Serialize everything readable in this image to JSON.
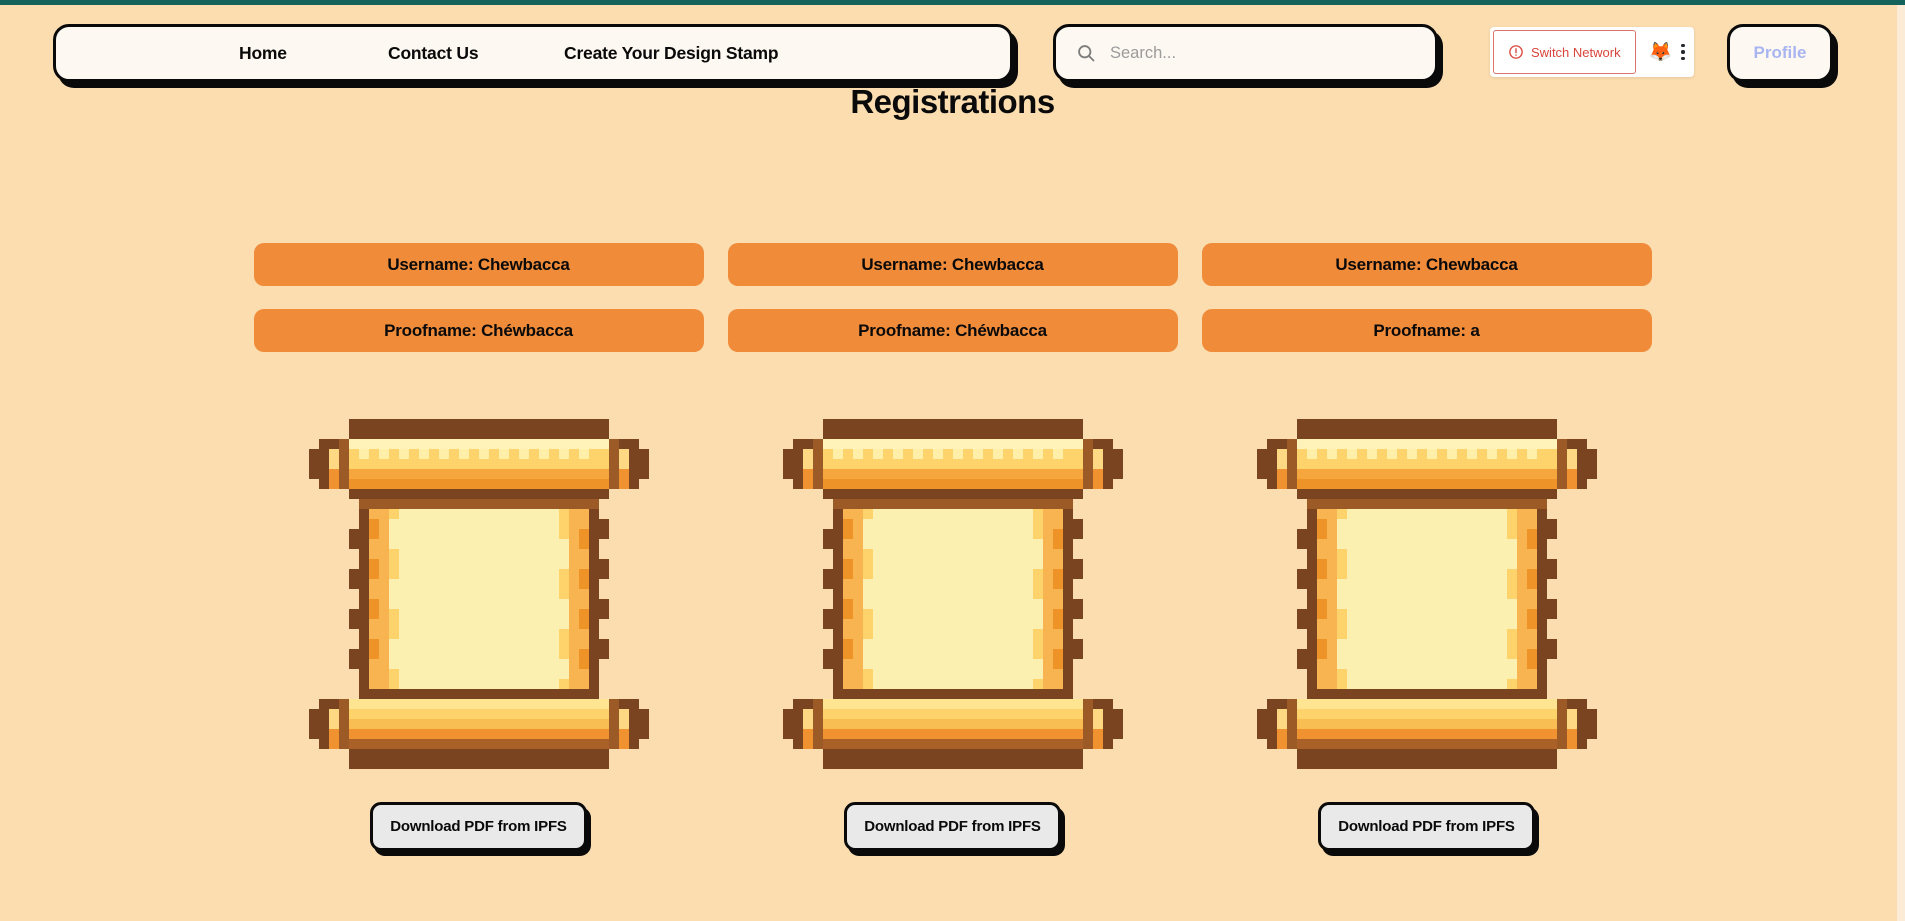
{
  "theme": {
    "page_background": "#FCDDB0",
    "top_strip": "#14625C",
    "pill_orange": "#F08B3A",
    "accent_border": "#0A0A0A",
    "profile_text": "#A9B5F0",
    "switch_network_red": "#D9453C",
    "download_button_bg": "#E9E9E9"
  },
  "navbar": {
    "links": [
      {
        "label": "Home",
        "name": "nav-link-home"
      },
      {
        "label": "Contact Us",
        "name": "nav-link-contact-us"
      },
      {
        "label": "Create Your Design Stamp",
        "name": "nav-link-create-your-design-stamp"
      }
    ],
    "search": {
      "placeholder": "Search...",
      "value": "",
      "icon": "search-icon"
    },
    "wallet": {
      "switch_network_label": "Switch Network",
      "warning_icon": "warning-circle-icon",
      "wallet_icon": "metamask-fox-icon",
      "wallet_glyph": "🦊",
      "menu_icon": "kebab-menu-icon"
    },
    "profile_label": "Profile"
  },
  "page": {
    "title": "Registrations"
  },
  "registrations": [
    {
      "username_label": "Username: Chewbacca",
      "proofname_label": "Proofname: Chéwbacca",
      "scroll_icon": "pixel-scroll-icon",
      "download_label": "Download PDF from IPFS"
    },
    {
      "username_label": "Username: Chewbacca",
      "proofname_label": "Proofname: Chéwbacca",
      "scroll_icon": "pixel-scroll-icon",
      "download_label": "Download PDF from IPFS"
    },
    {
      "username_label": "Username: Chewbacca",
      "proofname_label": "Proofname: a",
      "scroll_icon": "pixel-scroll-icon",
      "download_label": "Download PDF from IPFS"
    }
  ]
}
